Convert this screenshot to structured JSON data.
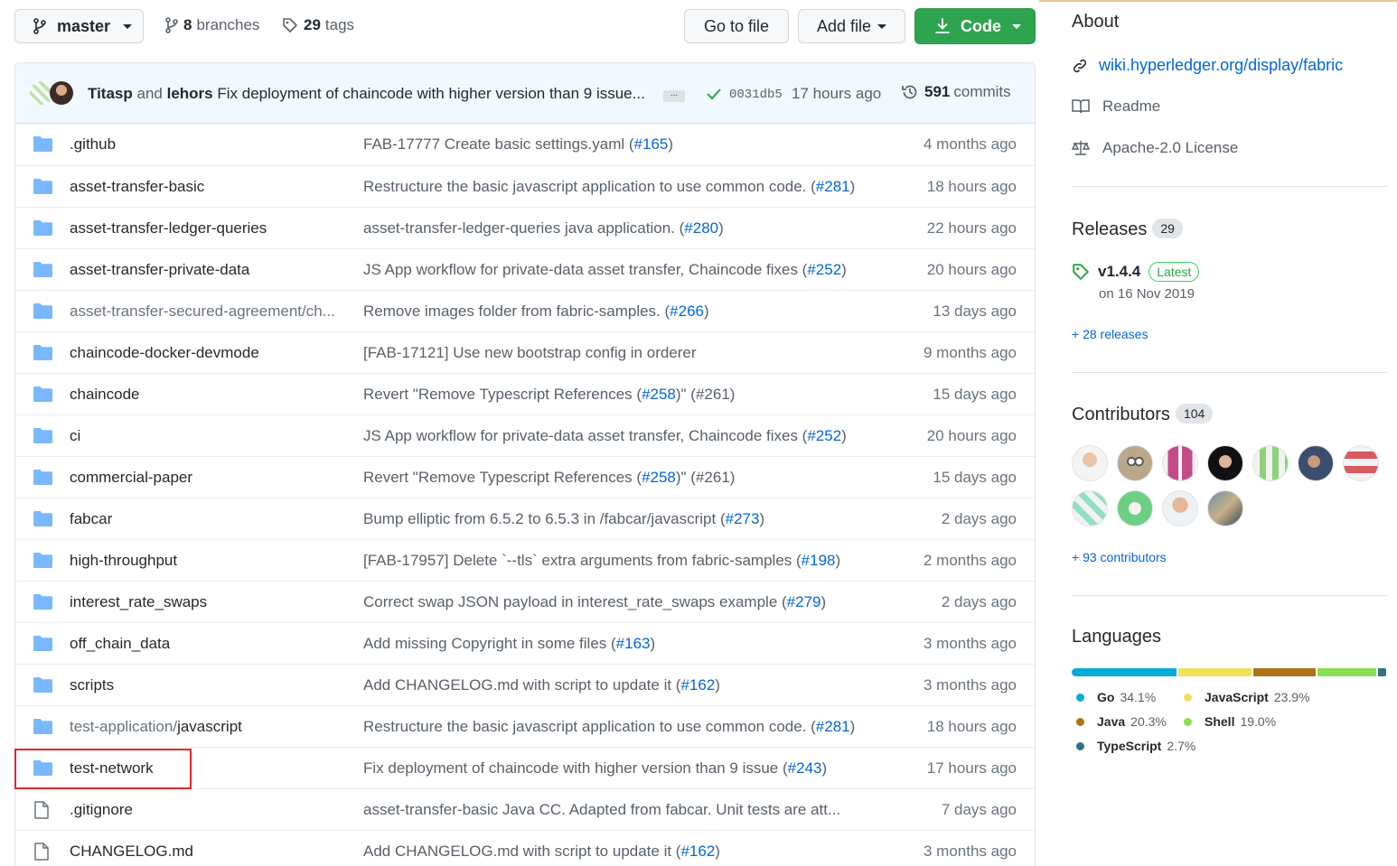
{
  "toolbar": {
    "branch": "master",
    "branches_count": "8",
    "branches_label": "branches",
    "tags_count": "29",
    "tags_label": "tags",
    "go_to_file": "Go to file",
    "add_file": "Add file",
    "code": "Code"
  },
  "commit": {
    "author1": "Titasp",
    "and": "and",
    "author2": "lehors",
    "message": "Fix deployment of chaincode with higher version than 9 issue...",
    "sha": "0031db5",
    "time": "17 hours ago",
    "commits_count": "591",
    "commits_label": "commits"
  },
  "files": [
    {
      "name": ".github",
      "type": "dir",
      "msg": "FAB-17777 Create basic settings.yaml (",
      "pr": "#165",
      "msg_end": ")",
      "age": "4 months ago"
    },
    {
      "name": "asset-transfer-basic",
      "type": "dir",
      "msg": "Restructure the basic javascript application to use common code. (",
      "pr": "#281",
      "msg_end": ")",
      "age": "18 hours ago"
    },
    {
      "name": "asset-transfer-ledger-queries",
      "type": "dir",
      "msg": "asset-transfer-ledger-queries java application. (",
      "pr": "#280",
      "msg_end": ")",
      "age": "22 hours ago"
    },
    {
      "name": "asset-transfer-private-data",
      "type": "dir",
      "msg": "JS App workflow for private-data asset transfer, Chaincode fixes (",
      "pr": "#252",
      "msg_end": ")",
      "age": "20 hours ago"
    },
    {
      "name": "asset-transfer-secured-agreement/ch...",
      "type": "dir",
      "dim": true,
      "msg": "Remove images folder from fabric-samples. (",
      "pr": "#266",
      "msg_end": ")",
      "age": "13 days ago"
    },
    {
      "name": "chaincode-docker-devmode",
      "type": "dir",
      "msg": "[FAB-17121] Use new bootstrap config in orderer",
      "pr": "",
      "msg_end": "",
      "age": "9 months ago"
    },
    {
      "name": "chaincode",
      "type": "dir",
      "msg": "Revert \"Remove Typescript References (",
      "pr": "#258",
      "msg_end": ")\" (#261)",
      "age": "15 days ago"
    },
    {
      "name": "ci",
      "type": "dir",
      "msg": "JS App workflow for private-data asset transfer, Chaincode fixes (",
      "pr": "#252",
      "msg_end": ")",
      "age": "20 hours ago"
    },
    {
      "name": "commercial-paper",
      "type": "dir",
      "msg": "Revert \"Remove Typescript References (",
      "pr": "#258",
      "msg_end": ")\" (#261)",
      "age": "15 days ago"
    },
    {
      "name": "fabcar",
      "type": "dir",
      "msg": "Bump elliptic from 6.5.2 to 6.5.3 in /fabcar/javascript (",
      "pr": "#273",
      "msg_end": ")",
      "age": "2 days ago"
    },
    {
      "name": "high-throughput",
      "type": "dir",
      "msg": "[FAB-17957] Delete `--tls` extra arguments from fabric-samples (",
      "pr": "#198",
      "msg_end": ")",
      "age": "2 months ago"
    },
    {
      "name": "interest_rate_swaps",
      "type": "dir",
      "msg": "Correct swap JSON payload in interest_rate_swaps example (",
      "pr": "#279",
      "msg_end": ")",
      "age": "2 days ago"
    },
    {
      "name": "off_chain_data",
      "type": "dir",
      "msg": "Add missing Copyright in some files (",
      "pr": "#163",
      "msg_end": ")",
      "age": "3 months ago"
    },
    {
      "name": "scripts",
      "type": "dir",
      "msg": "Add CHANGELOG.md with script to update it (",
      "pr": "#162",
      "msg_end": ")",
      "age": "3 months ago"
    },
    {
      "name": "test-application/",
      "type": "dir",
      "dim": true,
      "name_dark": "javascript",
      "msg": "Restructure the basic javascript application to use common code. (",
      "pr": "#281",
      "msg_end": ")",
      "age": "18 hours ago"
    },
    {
      "name": "test-network",
      "type": "dir",
      "msg": "Fix deployment of chaincode with higher version than 9 issue (",
      "pr": "#243",
      "msg_end": ")",
      "age": "17 hours ago"
    },
    {
      "name": ".gitignore",
      "type": "file",
      "msg": "asset-transfer-basic Java CC. Adapted from fabcar. Unit tests are att...",
      "pr": "",
      "msg_end": "",
      "age": "7 days ago"
    },
    {
      "name": "CHANGELOG.md",
      "type": "file",
      "msg": "Add CHANGELOG.md with script to update it (",
      "pr": "#162",
      "msg_end": ")",
      "age": "3 months ago"
    }
  ],
  "about": {
    "title": "About",
    "link": "wiki.hyperledger.org/display/fabric",
    "readme": "Readme",
    "license": "Apache-2.0 License"
  },
  "releases": {
    "title": "Releases",
    "count": "29",
    "version": "v1.4.4",
    "badge": "Latest",
    "date": "on 16 Nov 2019",
    "more": "+ 28 releases"
  },
  "contributors": {
    "title": "Contributors",
    "count": "104",
    "more": "+ 93 contributors"
  },
  "languages": {
    "title": "Languages",
    "items": [
      {
        "name": "Go",
        "pct": "34.1%",
        "value": 34.1,
        "color": "#00add8"
      },
      {
        "name": "JavaScript",
        "pct": "23.9%",
        "value": 23.9,
        "color": "#f1e05a"
      },
      {
        "name": "Java",
        "pct": "20.3%",
        "value": 20.3,
        "color": "#b07219"
      },
      {
        "name": "Shell",
        "pct": "19.0%",
        "value": 19.0,
        "color": "#89e051"
      },
      {
        "name": "TypeScript",
        "pct": "2.7%",
        "value": 2.7,
        "color": "#2b7489"
      }
    ]
  }
}
